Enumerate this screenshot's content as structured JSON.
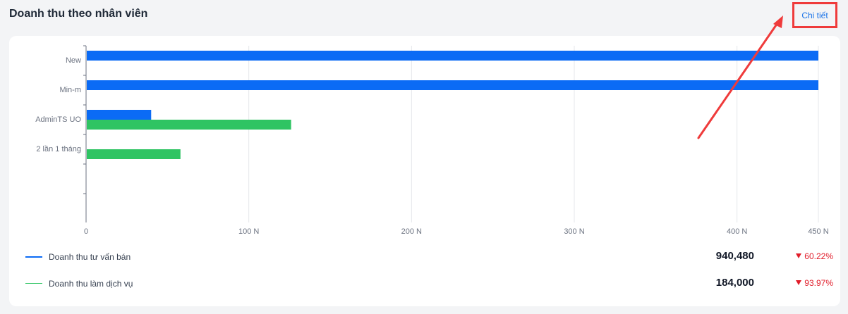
{
  "header": {
    "title": "Doanh thu theo nhân viên",
    "detail_link": "Chi tiết"
  },
  "chart_data": {
    "type": "bar",
    "orientation": "horizontal",
    "categories": [
      "New",
      "Min-m",
      "AdminTS UO",
      "2 lần 1 tháng"
    ],
    "series": [
      {
        "name": "Doanh thu tư vấn bán",
        "color": "#0b6bf5",
        "values": [
          450,
          450,
          40,
          0
        ]
      },
      {
        "name": "Doanh thu làm dịch vụ",
        "color": "#2fc463",
        "values": [
          0,
          0,
          126,
          58
        ]
      }
    ],
    "x_ticks": [
      "0",
      "100 N",
      "200 N",
      "300 N",
      "400 N",
      "450 N"
    ],
    "x_tick_values": [
      0,
      100,
      200,
      300,
      400,
      450
    ],
    "xlim": [
      0,
      450
    ],
    "grid": true,
    "legend_position": "bottom"
  },
  "legend": [
    {
      "label": "Doanh thu tư vấn bán",
      "value": "940,480",
      "change": "60.22%",
      "color": "#0b6bf5"
    },
    {
      "label": "Doanh thu làm dịch vụ",
      "value": "184,000",
      "change": "93.97%",
      "color": "#2fc463"
    }
  ],
  "colors": {
    "accent": "#1a73e8",
    "negative": "#e11d2a",
    "annotation": "#ef3b3b"
  }
}
